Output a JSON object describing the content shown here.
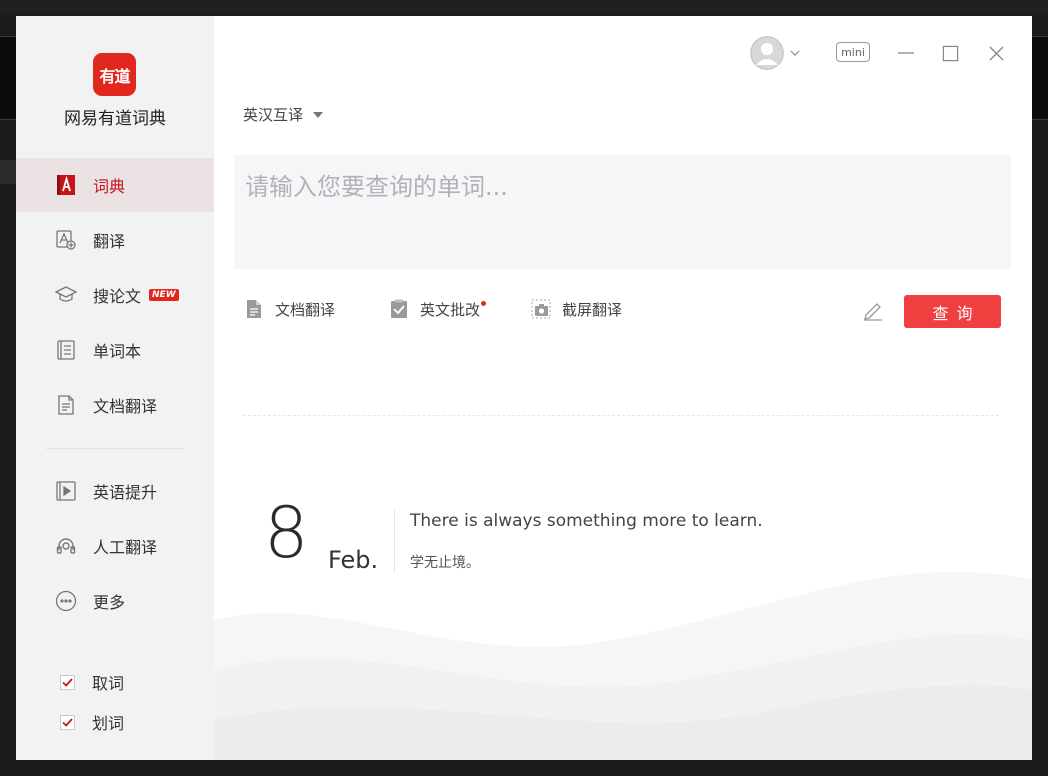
{
  "app": {
    "name": "网易有道词典",
    "logo_text": "有道",
    "brand_color": "#e0281e"
  },
  "sidebar": {
    "items": [
      {
        "label": "词典",
        "icon": "dictionary-icon",
        "active": true
      },
      {
        "label": "翻译",
        "icon": "translate-icon",
        "active": false
      },
      {
        "label": "搜论文",
        "icon": "graduation-cap-icon",
        "active": false,
        "badge": "NEW"
      },
      {
        "label": "单词本",
        "icon": "wordbook-icon",
        "active": false
      },
      {
        "label": "文档翻译",
        "icon": "document-icon",
        "active": false
      },
      {
        "label": "英语提升",
        "icon": "video-play-icon",
        "active": false
      },
      {
        "label": "人工翻译",
        "icon": "headset-icon",
        "active": false
      },
      {
        "label": "更多",
        "icon": "more-icon",
        "active": false
      }
    ],
    "checks": [
      {
        "label": "取词",
        "checked": true
      },
      {
        "label": "划词",
        "checked": true
      }
    ]
  },
  "header": {
    "mini_label": "mini"
  },
  "main": {
    "lang_mode": "英汉互译",
    "search_placeholder": "请输入您要查询的单词...",
    "tools": [
      {
        "label": "文档翻译",
        "icon": "document-icon"
      },
      {
        "label": "英文批改",
        "icon": "check-list-icon",
        "dot": true
      },
      {
        "label": "截屏翻译",
        "icon": "screenshot-camera-icon"
      }
    ],
    "query_label": "查询",
    "accent_color": "#ef3f3f"
  },
  "daily": {
    "day": "8",
    "month": "Feb.",
    "quote_en": "There is always something more to learn.",
    "quote_cn": "学无止境。"
  }
}
